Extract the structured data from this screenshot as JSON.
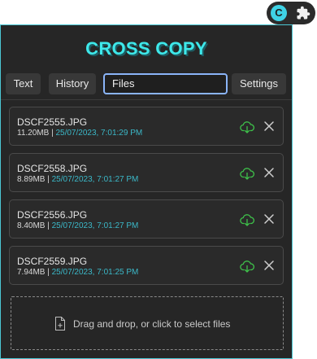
{
  "extension_bar": {
    "badge_letter": "C",
    "icons": [
      "cross-copy-extension-icon",
      "puzzle-icon"
    ]
  },
  "app": {
    "title": "CROSS COPY"
  },
  "tabs": [
    {
      "label": "Text",
      "active": false
    },
    {
      "label": "History",
      "active": false
    },
    {
      "label": "Files",
      "active": true
    },
    {
      "label": "Settings",
      "active": false
    }
  ],
  "files": [
    {
      "name": "DSCF2555.JPG",
      "size": "11.20MB",
      "separator": " | ",
      "timestamp": "25/07/2023, 7:01:29 PM"
    },
    {
      "name": "DSCF2558.JPG",
      "size": "8.89MB",
      "separator": " | ",
      "timestamp": "25/07/2023, 7:01:27 PM"
    },
    {
      "name": "DSCF2556.JPG",
      "size": "8.40MB",
      "separator": " | ",
      "timestamp": "25/07/2023, 7:01:27 PM"
    },
    {
      "name": "DSCF2559.JPG",
      "size": "7.94MB",
      "separator": " | ",
      "timestamp": "25/07/2023, 7:01:25 PM"
    }
  ],
  "dropzone": {
    "text": "Drag and drop, or click to select files",
    "icon": "file-plus-icon"
  },
  "colors": {
    "accent": "#3ee8ea",
    "timestamp": "#3bb8c8",
    "download_icon": "#3ec24a",
    "panel_bg": "#262626"
  }
}
